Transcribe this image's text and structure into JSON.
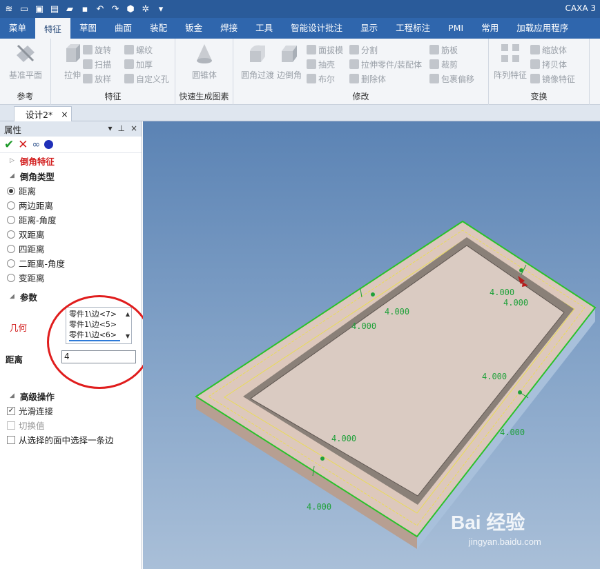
{
  "app": {
    "title": "CAXA 3"
  },
  "quick_access": [
    "app-logo-icon",
    "new-file-icon",
    "open-folder-icon",
    "doc-icon",
    "open-icon",
    "save-icon",
    "undo-icon",
    "redo-icon",
    "part-icon",
    "sparkle-icon",
    "dropdown-icon"
  ],
  "menu": {
    "items": [
      "菜单",
      "特征",
      "草图",
      "曲面",
      "装配",
      "钣金",
      "焊接",
      "工具",
      "智能设计批注",
      "显示",
      "工程标注",
      "PMI",
      "常用",
      "加载应用程序"
    ],
    "active": "特征"
  },
  "ribbon": {
    "groups": [
      {
        "label": "参考",
        "buttons": [
          "基准平面"
        ]
      },
      {
        "label": "特征",
        "buttons": [
          "拉伸",
          "旋转",
          "扫描",
          "放样",
          "螺纹",
          "加厚",
          "自定义孔"
        ]
      },
      {
        "label": "快速生成图素",
        "buttons": [
          "圆锥体"
        ]
      },
      {
        "label": "修改",
        "buttons": [
          "圆角过渡",
          "边倒角",
          "面拔模",
          "抽壳",
          "布尔",
          "分割",
          "拉伸零件/装配体",
          "删除体",
          "筋板",
          "裁剪",
          "包裹偏移"
        ]
      },
      {
        "label": "变换",
        "buttons": [
          "阵列特征",
          "缩放体",
          "拷贝体",
          "镜像特征"
        ]
      }
    ]
  },
  "doc_tab": {
    "label": "设计2*",
    "close": "×"
  },
  "properties": {
    "header": "属性",
    "header_controls": [
      "▾",
      "⊥",
      "×"
    ],
    "feature_title": "倒角特征",
    "chamfer_type": {
      "label": "倒角类型",
      "options": [
        "距离",
        "两边距离",
        "距离-角度",
        "双距离",
        "四距离",
        "二距离-角度",
        "变距离"
      ],
      "selected": "距离"
    },
    "params": {
      "label": "参数",
      "geometry_label": "几何",
      "geometry_items": [
        "零件1\\边<7>",
        "零件1\\边<5>",
        "零件1\\边<6>"
      ],
      "distance_label": "距离",
      "distance_value": "4"
    },
    "advanced": {
      "label": "高级操作",
      "options": [
        {
          "label": "光滑连接",
          "checked": true,
          "enabled": true
        },
        {
          "label": "切换值",
          "checked": false,
          "enabled": false
        },
        {
          "label": "从选择的面中选择一条边",
          "checked": false,
          "enabled": true
        }
      ]
    }
  },
  "viewport": {
    "dimension_labels": [
      "4.000",
      "4.000",
      "4.000",
      "4.000",
      "4.000",
      "4.000",
      "4.000",
      "4.000"
    ],
    "colors": {
      "edge": "#2ac12a",
      "dim": "#1fa13a",
      "face_top": "#ddc8bc",
      "face_side": "#c5aea3"
    }
  },
  "watermark": {
    "brand": "Bai  经验",
    "url": "jingyan.baidu.com"
  }
}
